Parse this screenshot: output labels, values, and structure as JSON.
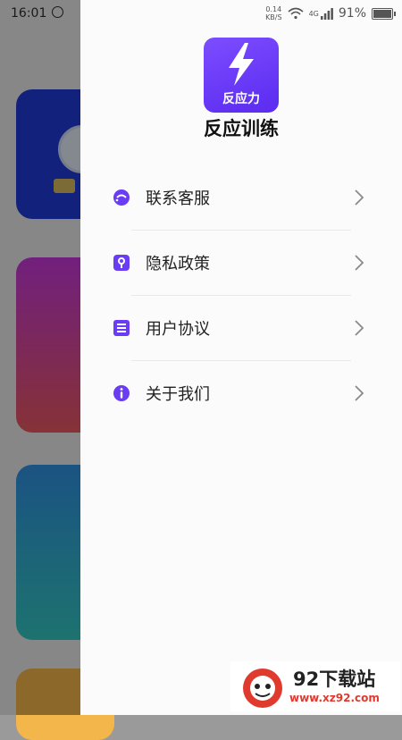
{
  "background_app": {
    "time": "16:01"
  },
  "status_bar": {
    "net_speed_value": "0.14",
    "net_speed_unit": "KB/S",
    "signal_label": "4G",
    "battery_percent": "91%",
    "battery_level": 0.91
  },
  "drawer": {
    "logo_caption": "反应力",
    "app_title": "反应训练",
    "menu": [
      {
        "label": "联系客服",
        "icon": "chat-icon"
      },
      {
        "label": "隐私政策",
        "icon": "lock-icon"
      },
      {
        "label": "用户协议",
        "icon": "document-icon"
      },
      {
        "label": "关于我们",
        "icon": "info-icon"
      }
    ]
  },
  "watermark": {
    "title": "92下载站",
    "url": "www.xz92.com"
  },
  "colors": {
    "accent": "#6a3df5",
    "overlay": "#000000"
  }
}
